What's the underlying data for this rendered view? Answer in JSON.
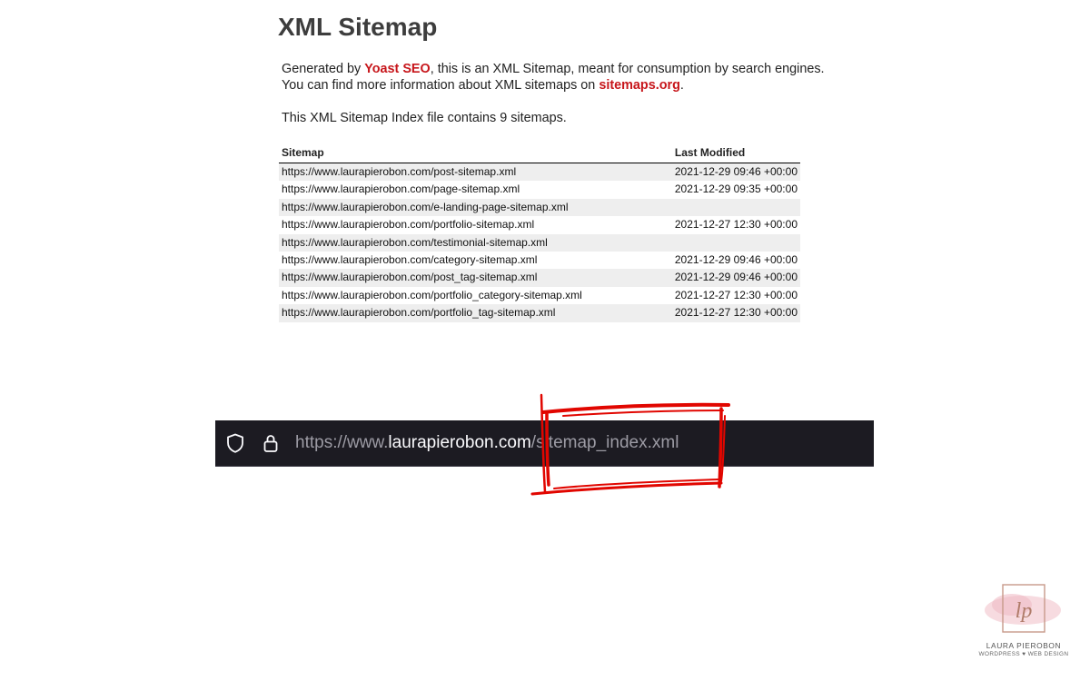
{
  "page": {
    "title": "XML Sitemap",
    "intro_line1_before": "Generated by ",
    "intro_line1_link": "Yoast SEO",
    "intro_line1_after": ", this is an XML Sitemap, meant for consumption by search engines.",
    "intro_line2_before": "You can find more information about XML sitemaps on ",
    "intro_line2_link": "sitemaps.org",
    "intro_line2_after": ".",
    "summary": "This XML Sitemap Index file contains 9 sitemaps.",
    "link_color": "#c7161b"
  },
  "table": {
    "headers": [
      "Sitemap",
      "Last Modified"
    ],
    "rows": [
      {
        "url": "https://www.laurapierobon.com/post-sitemap.xml",
        "modified": "2021-12-29 09:46 +00:00"
      },
      {
        "url": "https://www.laurapierobon.com/page-sitemap.xml",
        "modified": "2021-12-29 09:35 +00:00"
      },
      {
        "url": "https://www.laurapierobon.com/e-landing-page-sitemap.xml",
        "modified": ""
      },
      {
        "url": "https://www.laurapierobon.com/portfolio-sitemap.xml",
        "modified": "2021-12-27 12:30 +00:00"
      },
      {
        "url": "https://www.laurapierobon.com/testimonial-sitemap.xml",
        "modified": ""
      },
      {
        "url": "https://www.laurapierobon.com/category-sitemap.xml",
        "modified": "2021-12-29 09:46 +00:00"
      },
      {
        "url": "https://www.laurapierobon.com/post_tag-sitemap.xml",
        "modified": "2021-12-29 09:46 +00:00"
      },
      {
        "url": "https://www.laurapierobon.com/portfolio_category-sitemap.xml",
        "modified": "2021-12-27 12:30 +00:00"
      },
      {
        "url": "https://www.laurapierobon.com/portfolio_tag-sitemap.xml",
        "modified": "2021-12-27 12:30 +00:00"
      }
    ]
  },
  "urlbar": {
    "scheme": "https://www.",
    "host": "laurapierobon.com",
    "path": "/sitemap_index.xml",
    "icons": [
      "shield-icon",
      "lock-icon"
    ],
    "background": "#1c1b22"
  },
  "annotation": {
    "color": "#e10600",
    "icon": "red-highlight-box"
  },
  "logo": {
    "monogram": "lp",
    "name": "LAURA PIEROBON",
    "tagline": "WORDPRESS ♥ WEB DESIGN"
  }
}
